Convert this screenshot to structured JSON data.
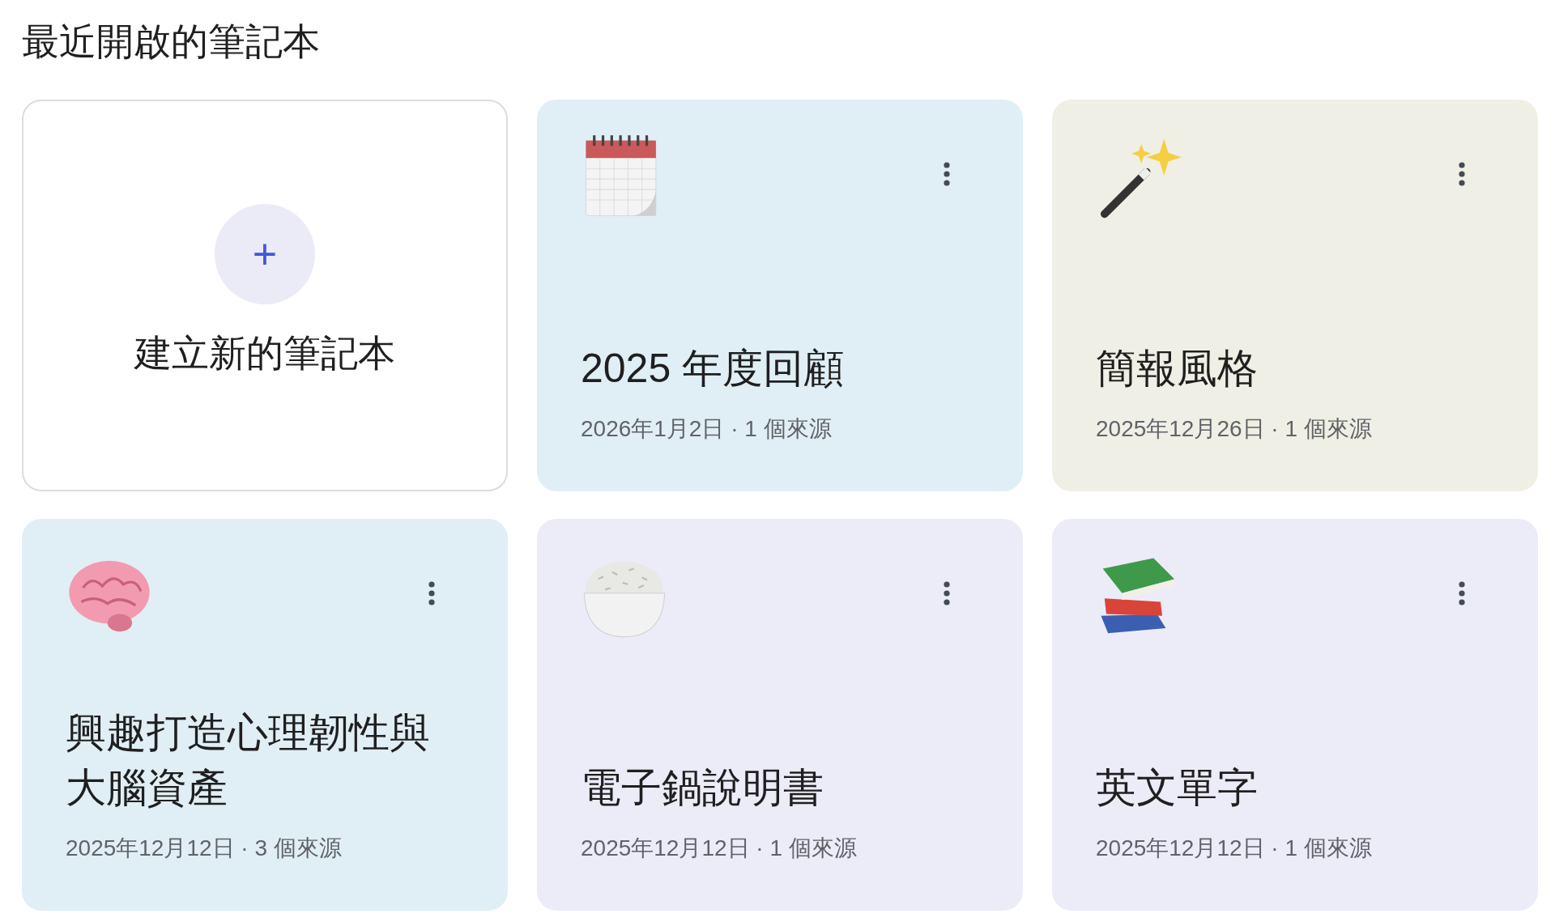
{
  "heading": "最近開啟的筆記本",
  "create_card": {
    "label": "建立新的筆記本",
    "button": "+"
  },
  "notebooks": [
    {
      "kind": "calendar",
      "color": "#e0eff5",
      "title": "2025 年度回顧",
      "meta": "2026年1月2日 · 1 個來源"
    },
    {
      "kind": "wand",
      "color": "#f0efe5",
      "title": "簡報風格",
      "meta": "2025年12月26日 · 1 個來源"
    },
    {
      "kind": "brain",
      "color": "#e0eff5",
      "title": "興趣打造心理韌性與大腦資產",
      "meta": "2025年12月12日 · 3 個來源"
    },
    {
      "kind": "rice",
      "color": "#ecebf8",
      "title": "電子鍋說明書",
      "meta": "2025年12月12日 · 1 個來源"
    },
    {
      "kind": "books",
      "color": "#ecebf8",
      "title": "英文單字",
      "meta": "2025年12月12日 · 1 個來源"
    }
  ]
}
